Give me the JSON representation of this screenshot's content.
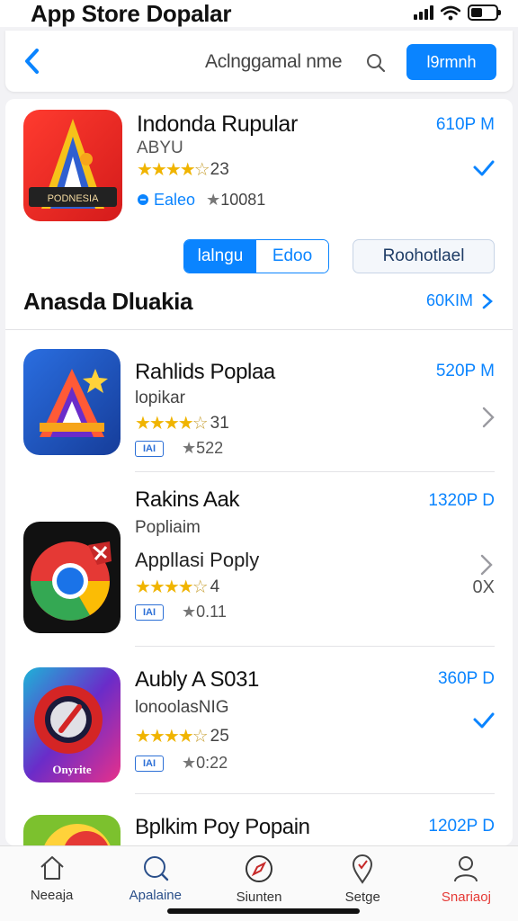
{
  "status_bar": {
    "title": "App Store Dopalar"
  },
  "nav": {
    "search_text": "Aclnggamal nme",
    "action_label": "l9rmnh"
  },
  "featured": {
    "name": "Indonda Rupular",
    "subtitle": "ABYU",
    "stars": 4,
    "rating": "23",
    "language": "Ealeo",
    "downloads": "10081",
    "price": "610P M",
    "icon_text": "PODNESIA",
    "segment": {
      "left": "lalngu",
      "right": "Edoo"
    },
    "secondary_button": "Roohotlael"
  },
  "section": {
    "title": "Anasda Dluakia",
    "link": "60KIM"
  },
  "apps": [
    {
      "name": "Rahlids Poplaa",
      "subtitle": "lopikar",
      "subtitle2": "",
      "stars": 4,
      "rating": "31",
      "badge": "IAI",
      "downloads": "522",
      "price": "520P M",
      "icon": "triangle-star"
    },
    {
      "name": "Rakins Aak",
      "subtitle": "Popliaim",
      "subtitle2": "Appllasi Poply",
      "stars": 4,
      "rating": "4",
      "badge": "IAI",
      "downloads": "0.11",
      "price": "1320P D",
      "extra": "0X",
      "icon": "chrome"
    },
    {
      "name": "Aubly A S031",
      "subtitle": "lonoolasNIG",
      "subtitle2": "",
      "stars": 4,
      "rating": "25",
      "badge": "IAI",
      "downloads": "0:22",
      "price": "360P D",
      "icon_text": "Onyrite",
      "icon": "red-circle"
    },
    {
      "name": "Bplkim Poy Popain",
      "price": "1202P D",
      "icon": "citrus"
    }
  ],
  "tabs": [
    {
      "label": "Neeaja",
      "icon": "home-icon"
    },
    {
      "label": "Apalaine",
      "icon": "search-icon"
    },
    {
      "label": "Siunten",
      "icon": "compass-icon"
    },
    {
      "label": "Setge",
      "icon": "location-icon"
    },
    {
      "label": "Snariaoj",
      "icon": "person-icon"
    }
  ],
  "colors": {
    "accent": "#0a84ff",
    "star": "#f0b400",
    "active_tab": "#e53935"
  }
}
